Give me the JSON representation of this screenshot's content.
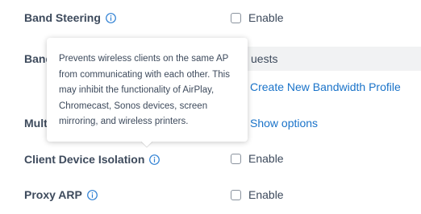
{
  "settings": {
    "band_steering": {
      "label": "Band Steering",
      "option_label": "Enable",
      "checked": false
    },
    "bandwidth": {
      "label": "Band",
      "select_value": "uests",
      "create_link": "Create New Bandwidth Profile"
    },
    "multicast": {
      "label": "Mult",
      "show_options_link": "Show options"
    },
    "client_isolation": {
      "label": "Client Device Isolation",
      "option_label": "Enable",
      "checked": false
    },
    "proxy_arp": {
      "label": "Proxy ARP",
      "option_label": "Enable",
      "checked": false
    }
  },
  "tooltip": {
    "text": "Prevents wireless clients on the same AP from communicating with each other. This may inhibit the functionality of AirPlay, Chromecast, Sonos devices, screen mirroring, and wireless printers."
  },
  "colors": {
    "text": "#3d4a5c",
    "link": "#1a73c9",
    "info_icon": "#2d7fd3",
    "select_bg": "#f1f2f3"
  },
  "icons": {
    "info": "info-circle-icon"
  }
}
